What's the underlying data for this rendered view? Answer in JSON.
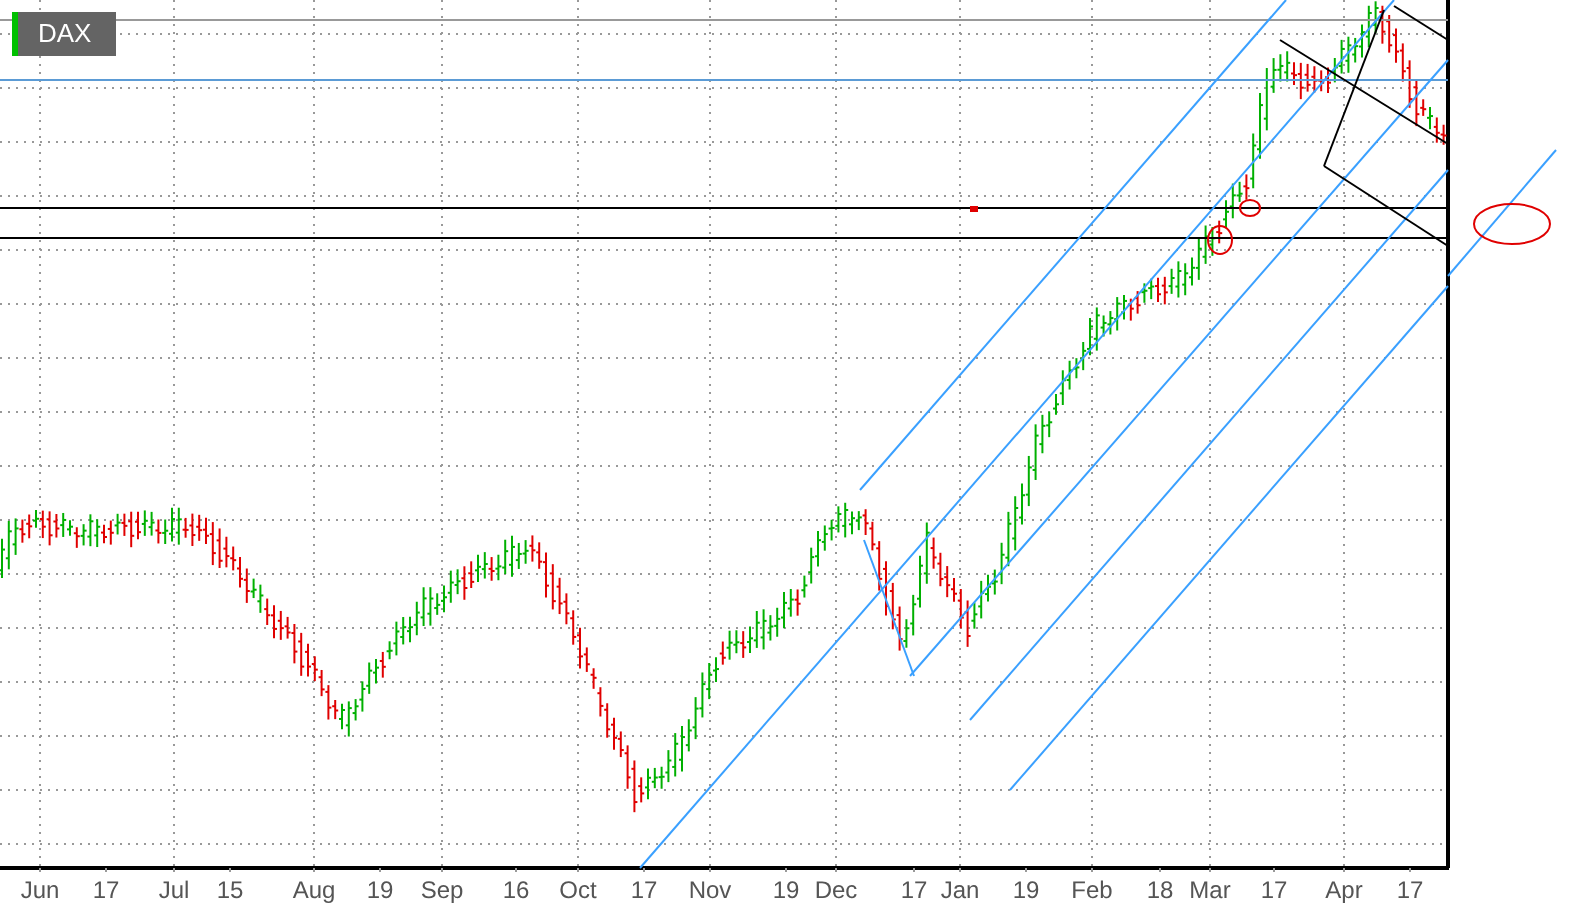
{
  "legend": {
    "label": "DAX"
  },
  "x_axis": {
    "labels": [
      "Jun",
      "17",
      "Jul",
      "15",
      "Aug",
      "19",
      "Sep",
      "16",
      "Oct",
      "17",
      "Nov",
      "19",
      "Dec",
      "17",
      "Jan",
      "19",
      "Feb",
      "18",
      "Mar",
      "17",
      "Apr",
      "17"
    ]
  }
}
